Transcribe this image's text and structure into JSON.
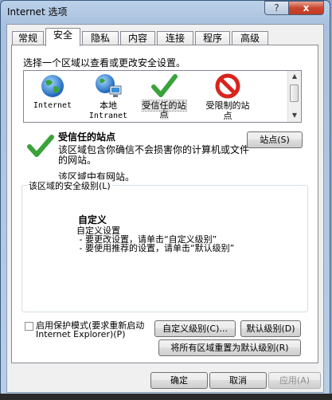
{
  "window": {
    "title": "Internet 选项",
    "help_label": "?",
    "close_label": "x"
  },
  "tabs": [
    {
      "label": "常规"
    },
    {
      "label": "安全"
    },
    {
      "label": "隐私"
    },
    {
      "label": "内容"
    },
    {
      "label": "连接"
    },
    {
      "label": "程序"
    },
    {
      "label": "高级"
    }
  ],
  "security": {
    "zone_prompt": "选择一个区域以查看或更改安全设置。",
    "zones": [
      {
        "line1": "Internet",
        "line2": ""
      },
      {
        "line1": "本地",
        "line2": "Intranet"
      },
      {
        "line1": "受信任的站",
        "line2": "点"
      },
      {
        "line1": "受限制的站",
        "line2": "点"
      }
    ],
    "selected_zone_title": "受信任的站点",
    "selected_zone_desc": "该区域包含你确信不会损害你的计算机或文件的网站。",
    "zone_has_sites": "该区域中有网站。",
    "sites_button": "站点(S)",
    "level_group_label": "该区域的安全级别(L)",
    "level_title": "自定义",
    "level_desc": "自定义设置\n - 要更改设置，请单击“自定义级别”\n - 要使用推荐的设置，请单击“默认级别”",
    "protected_mode": "启用保护模式(要求重新启动 Internet Explorer)(P)",
    "custom_level_button": "自定义级别(C)...",
    "default_level_button": "默认级别(D)",
    "reset_all_button": "将所有区域重置为默认级别(R)"
  },
  "footer": {
    "ok": "确定",
    "cancel": "取消",
    "apply": "应用(A)"
  },
  "colors": {
    "window_frame": "#a9c1de",
    "close_red": "#c9462e",
    "check_green": "#3aa23a",
    "restricted_red": "#d8241c"
  }
}
